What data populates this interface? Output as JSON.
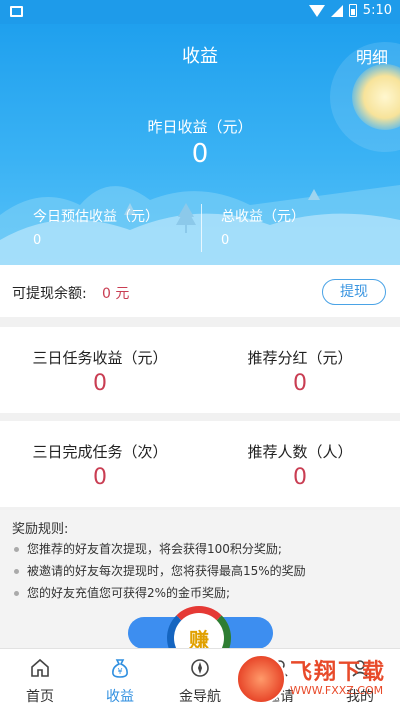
{
  "status_bar": {
    "time": "5:10",
    "icons": [
      "image-icon",
      "wifi-icon",
      "signal-icon",
      "battery-icon"
    ]
  },
  "header": {
    "title": "收益",
    "detail_link": "明细"
  },
  "hero": {
    "yesterday_label": "昨日收益（元）",
    "yesterday_value": "0",
    "today_label": "今日预估收益（元）",
    "today_value": "0",
    "total_label": "总收益（元）",
    "total_value": "0"
  },
  "withdraw": {
    "label": "可提现余额:",
    "amount": "0 元",
    "button": "提现"
  },
  "stats": {
    "task_income_label": "三日任务收益（元）",
    "task_income_value": "0",
    "referral_bonus_label": "推荐分红（元）",
    "referral_bonus_value": "0",
    "tasks_done_label": "三日完成任务（次）",
    "tasks_done_value": "0",
    "referrals_label": "推荐人数（人）",
    "referrals_value": "0"
  },
  "rules": {
    "title": "奖励规则:",
    "items": [
      "您推荐的好友首次提现，将会获得100积分奖励;",
      "被邀请的好友每次提现时，您将获得最高15%的奖励",
      "您的好友充值您可获得2%的金币奖励;"
    ],
    "logo_text": "赚"
  },
  "tabs": [
    {
      "label": "首页",
      "icon": "home-icon"
    },
    {
      "label": "收益",
      "icon": "money-bag-icon"
    },
    {
      "label": "金导航",
      "icon": "compass-icon"
    },
    {
      "label": "邀请",
      "icon": "invite-icon"
    },
    {
      "label": "我的",
      "icon": "user-icon"
    }
  ],
  "watermark": {
    "text": "飞翔下载",
    "url": "WWW.FXXZ.COM"
  },
  "colors": {
    "primary": "#1e9bea",
    "accent_red": "#c93d52",
    "tab_active": "#2f8fe0",
    "button": "#3d8ef0"
  }
}
